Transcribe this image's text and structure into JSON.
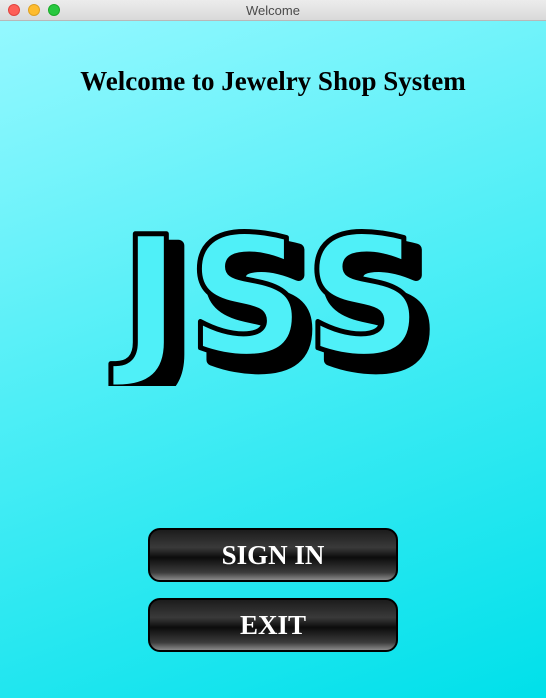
{
  "window": {
    "title": "Welcome"
  },
  "main": {
    "heading": "Welcome to Jewelry Shop System",
    "logo_text": "JSS"
  },
  "buttons": {
    "sign_in": "SIGN IN",
    "exit": "EXIT"
  },
  "colors": {
    "background_light": "#94f8ff",
    "background_dark": "#00e0ea",
    "button": "#000000",
    "button_text": "#ffffff"
  }
}
